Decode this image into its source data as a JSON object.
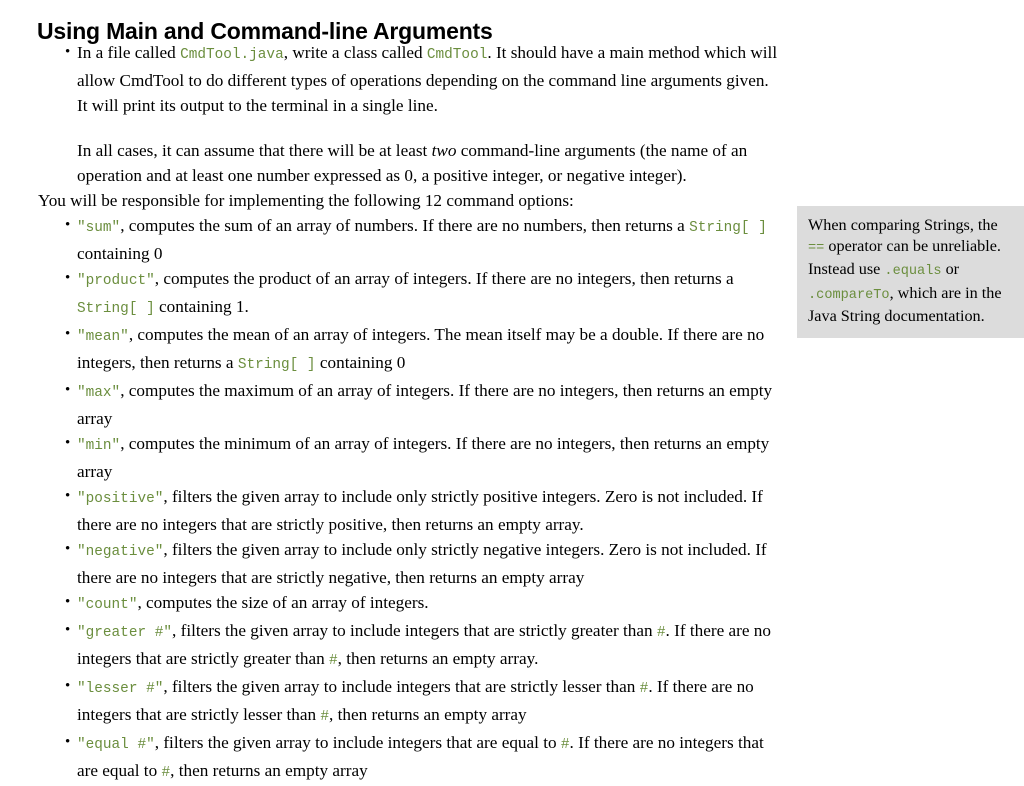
{
  "document": {
    "title": "Using Main and Command-line Arguments"
  },
  "intro": {
    "bullet": {
      "part1": "In a file called ",
      "code1": "CmdTool.java",
      "part2": ", write a class called ",
      "code2": "CmdTool",
      "part3": ". It should have a main method which will allow CmdTool to do different types of operations depending on the command line arguments given. It will print its output to the terminal in a single line.",
      "paragraph2_part1": "In all cases, it can assume that there will be at least ",
      "paragraph2_emphasis": "two",
      "paragraph2_part2": " command-line arguments (the name of an operation and at least one number expressed as 0, a positive integer, or negative integer)."
    },
    "lead_line": "You will be responsible for implementing the following 12 command options:"
  },
  "options": [
    {
      "code": "\"sum\"",
      "text_after": ", computes the sum of an array of numbers. If there are no numbers, then returns a ",
      "code_mid": "String[ ]",
      "text_end": " containing 0"
    },
    {
      "code": "\"product\"",
      "text_after": ", computes the product of an array of integers. If there are no integers, then returns a ",
      "code_mid": "String[ ]",
      "text_end": " containing 1."
    },
    {
      "code": "\"mean\"",
      "text_after": ", computes the mean of an array of integers. The mean itself may be a double. If there are no integers, then returns a ",
      "code_mid": "String[ ]",
      "text_end": " containing 0"
    },
    {
      "code": "\"max\"",
      "text_after": ", computes the maximum of an array of integers. If there are no integers, then returns an empty array",
      "code_mid": "",
      "text_end": ""
    },
    {
      "code": "\"min\"",
      "text_after": ", computes the minimum of an array of integers. If there are no integers, then returns an empty array",
      "code_mid": "",
      "text_end": ""
    },
    {
      "code": "\"positive\"",
      "text_after": ", filters the given array to include only strictly positive integers. Zero is not included. If there are no integers that are strictly positive, then returns an empty array.",
      "code_mid": "",
      "text_end": ""
    },
    {
      "code": "\"negative\"",
      "text_after": ", filters the given array to include only strictly negative integers. Zero is not included. If there are no integers that are strictly negative, then returns an empty array",
      "code_mid": "",
      "text_end": ""
    },
    {
      "code": "\"count\"",
      "text_after": ", computes the size of an array of integers.",
      "code_mid": "",
      "text_end": ""
    },
    {
      "code": "\"greater #\"",
      "text_after": ", filters the given array to include integers that are strictly greater than ",
      "code_mid": "#",
      "text_end": ". If there are no integers that are strictly greater than ",
      "code_mid2": "#",
      "text_end2": ", then returns an empty array."
    },
    {
      "code": "\"lesser #\"",
      "text_after": ", filters the given array to include integers that are strictly lesser than ",
      "code_mid": "#",
      "text_end": ". If there are no integers that are strictly lesser than ",
      "code_mid2": "#",
      "text_end2": ", then returns an empty array"
    },
    {
      "code": "\"equal #\"",
      "text_after": ", filters the given array to include integers that are equal to ",
      "code_mid": "#",
      "text_end": ". If there are no integers that are equal to ",
      "code_mid2": "#",
      "text_end2": ", then returns an empty array"
    }
  ],
  "callout": {
    "part1": "When comparing Strings, the ",
    "code1": "==",
    "part2": " operator can be unreliable. Instead use ",
    "code2": ".equals",
    "part3": " or ",
    "code3": ".compareTo",
    "part4": ", which are in the Java String documentation."
  },
  "colors": {
    "code_green": "#6b8e3e",
    "callout_background": "#dcdcdc",
    "text": "#000000",
    "page_background": "#ffffff"
  }
}
